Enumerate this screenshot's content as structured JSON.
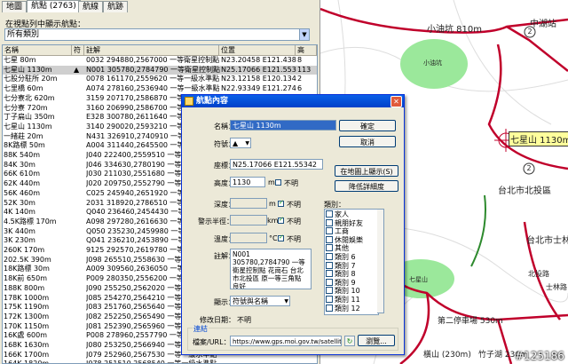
{
  "tabs": [
    "地圖",
    "航點 (2763)",
    "航線",
    "航跡"
  ],
  "filter_label": "在視點列中顯示航點：",
  "filter_value": "所有類別",
  "columns": [
    "名稱",
    "符",
    "註解",
    "位置",
    "高"
  ],
  "rows": [
    [
      "七星 80m",
      "",
      "0032 294880,2567000 一等衛星控制點 觀音石 凌網館...",
      "N23.20458 E121.43851",
      "8"
    ],
    [
      "七星山 1130m",
      "▲",
      "N001 305780,2784790 一等衛星控制點 花崗石 台北市...",
      "N25.17066 E121.55342",
      "113"
    ],
    [
      "七股分駐所 20m",
      "",
      "0078 161170,2559620 一等一級水準點 不銹鋼標 台南...",
      "N23.12158 E120.13462",
      "2"
    ],
    [
      "七里橋 60m",
      "",
      "A074 278160,2536940 一等一級水準點 不銹鋼標 台南...",
      "N22.93349 E121.27461",
      "6"
    ],
    [
      "七分寮北 620m",
      "",
      "3159 207170,2586870 一等一級水準點 不銹鋼標 台南...",
      "N23.35208 E120.56660",
      "62"
    ],
    [
      "七分寮 720m",
      "",
      "3160 206990,2586700 一等一級水準點 不銹鋼標 台南...",
      "",
      ""
    ],
    [
      "丁子扁山 350m",
      "",
      "E328 300780,2611640 一等衛星控制點",
      "",
      ""
    ],
    [
      "七星山 1130m",
      "",
      "3140 290020,2593210 一等衛星控制點",
      "",
      ""
    ],
    [
      "一緒莊 20m",
      "",
      "N431 326910,2740910 一等衛星控制點",
      "",
      ""
    ],
    [
      "8K路標 50m",
      "",
      "A004 311440,2645500 一等一級水準點",
      "",
      ""
    ],
    [
      "88K 540m",
      "",
      "J040 222400,2559510 一等一級水準點",
      "",
      ""
    ],
    [
      "84K 30m",
      "",
      "J046 334630,2780190 一等一級水準點",
      "",
      ""
    ],
    [
      "66K 610m",
      "",
      "J030 211030,2551680 一等一級水準點",
      "",
      ""
    ],
    [
      "62K 440m",
      "",
      "J020 209750,2552790 一等一級水準點",
      "",
      ""
    ],
    [
      "56K 460m",
      "",
      "C025 245940,2651920 一等一級水準點",
      "",
      ""
    ],
    [
      "52K 30m",
      "",
      "2031 318920,2786510 一等一級水準點",
      "",
      ""
    ],
    [
      "4K 140m",
      "",
      "Q040 236460,2454430 一等一級水準點",
      "",
      ""
    ],
    [
      "4.5K路標 170m",
      "",
      "A098 297280,2616630 一等一級水準點",
      "",
      ""
    ],
    [
      "3K 440m",
      "",
      "Q050 235230,2459980 一等一級水準點",
      "",
      ""
    ],
    [
      "3K 230m",
      "",
      "Q041 236210,2453890 一等一級水準點",
      "",
      ""
    ],
    [
      "260K 170m",
      "",
      "9125 292570,2619780 一等一級水準點",
      "",
      ""
    ],
    [
      "202.5K 390m",
      "",
      "J098 265510,2558630 一等一級水準點",
      "",
      ""
    ],
    [
      "18K路標 30m",
      "",
      "A009 309560,2636050 一等一級水準點",
      "",
      ""
    ],
    [
      "18K前 650m",
      "",
      "P009 280350,2556200 一等一級水準點",
      "",
      ""
    ],
    [
      "188K 800m",
      "",
      "J090 255250,2562020 一等一級水準點",
      "",
      ""
    ],
    [
      "178K 1000m",
      "",
      "J085 254270,2564210 一等一級水準點",
      "",
      ""
    ],
    [
      "175K 1190m",
      "",
      "J083 251760,2565640 一等一級水準點",
      "",
      ""
    ],
    [
      "172K 1300m",
      "",
      "J082 252250,2565490 一等一級水準點",
      "",
      ""
    ],
    [
      "170K 1150m",
      "",
      "J081 252390,2565960 一等一級水準點",
      "",
      ""
    ],
    [
      "16K處 600m",
      "",
      "P008 278960,2557790 一等一級水準點",
      "",
      ""
    ],
    [
      "168K 1630m",
      "",
      "J080 253250,2566940 一等一級水準點",
      "",
      ""
    ],
    [
      "166K 1700m",
      "",
      "J079 252960,2567530 一等一級水準點",
      "",
      ""
    ],
    [
      "164K 1820m",
      "",
      "J078 251510,2568540 一等一級水準點",
      "",
      ""
    ],
    [
      "162K 1910m",
      "",
      "J077 251050,2569010 一等一級水準點",
      "",
      ""
    ]
  ],
  "selected_row": 1,
  "map": {
    "labels": {
      "top": "小油坑 810m",
      "right": "中湖站",
      "park_a": "小油坑",
      "park_b": "七星山",
      "city": "台北市北投區",
      "city2": "台北市士林區",
      "selected": "七星山 1130m",
      "bottom1": "第二停車場 530m",
      "bottom2": "橫山 (230m)",
      "bottom3": "竹子湖 230m",
      "road": "北投路",
      "road2": "士林路"
    },
    "shields": [
      "2",
      "2"
    ],
    "watermark": "#125186"
  },
  "dialog": {
    "title": "航點內容",
    "name_label": "名稱：",
    "name_value": "七星山 1130m",
    "symbol_label": "符號：",
    "symbol_value": "▲",
    "coord_label": "座標：",
    "coord_value": "N25.17066 E121.55342",
    "alt_label": "高度：",
    "alt_value": "1130",
    "alt_unit": "m",
    "unknown": "不明",
    "depth_label": "深度：",
    "depth_unit": "m",
    "alarm_label": "警示半徑：",
    "alarm_unit": "km",
    "temp_label": "溫度：",
    "temp_unit": "°C",
    "note_label": "註解：",
    "note_value": "N001 305780,2784790 一等衛星控制點 花崗石 台北市北投區 原一等三角點 良好",
    "display_label": "顯示：",
    "display_value": "符號與名稱",
    "modified_label": "修改日期：",
    "modified_value": "不明",
    "link_group": "連結",
    "file_label": "檔案/URL：",
    "file_value": "https://www.gps.moi.gov.tw/satellite/",
    "browse": "瀏覽...",
    "ok": "確定",
    "cancel": "取消",
    "show_on_map": "在地圖上顯示(S)",
    "goto": "降低詳細度",
    "category_label": "類別：",
    "categories": [
      "家人",
      "親朋好友",
      "工商",
      "休閒娛樂",
      "其他",
      "類別 6",
      "類別 7",
      "類別 8",
      "類別 9",
      "類別 10",
      "類別 11",
      "類別 12"
    ]
  }
}
